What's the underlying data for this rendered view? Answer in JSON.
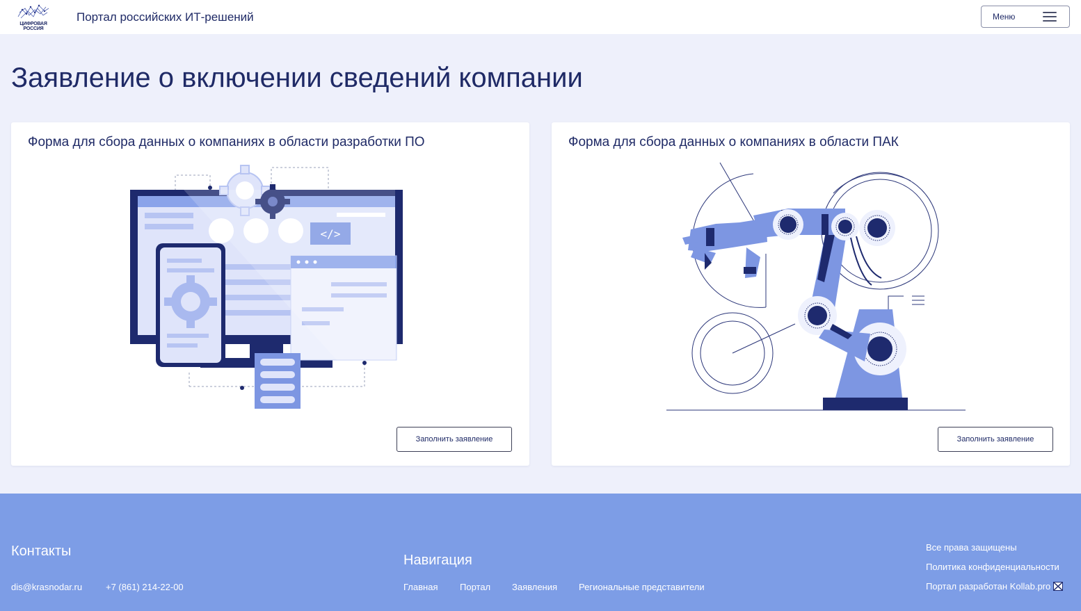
{
  "header": {
    "logo_text_line1": "ЦИФРОВАЯ",
    "logo_text_line2": "РОССИЯ",
    "portal_title": "Портал российских ИТ-решений",
    "menu_label": "Меню"
  },
  "main": {
    "title": "Заявление о включении сведений компании",
    "cards": [
      {
        "title": "Форма для сбора данных о компаниях в области разработки ПО",
        "button": "Заполнить заявление",
        "illustration": "software-development-illustration"
      },
      {
        "title": "Форма для сбора данных о компаниях в области ПАК",
        "button": "Заполнить заявление",
        "illustration": "robot-arm-illustration"
      }
    ]
  },
  "footer": {
    "contacts_title": "Контакты",
    "email": "dis@krasnodar.ru",
    "phone": "+7 (861) 214-22-00",
    "nav_title": "Навигация",
    "nav": [
      "Главная",
      "Портал",
      "Заявления",
      "Региональные представители"
    ],
    "rights": "Все права защищены",
    "privacy": "Политика конфиденциальности",
    "developed_by": "Портал разработан Kollab.pro"
  },
  "colors": {
    "primary_dark": "#1f2a66",
    "accent_blue": "#7d9de6",
    "page_bg": "#eef0fb"
  }
}
